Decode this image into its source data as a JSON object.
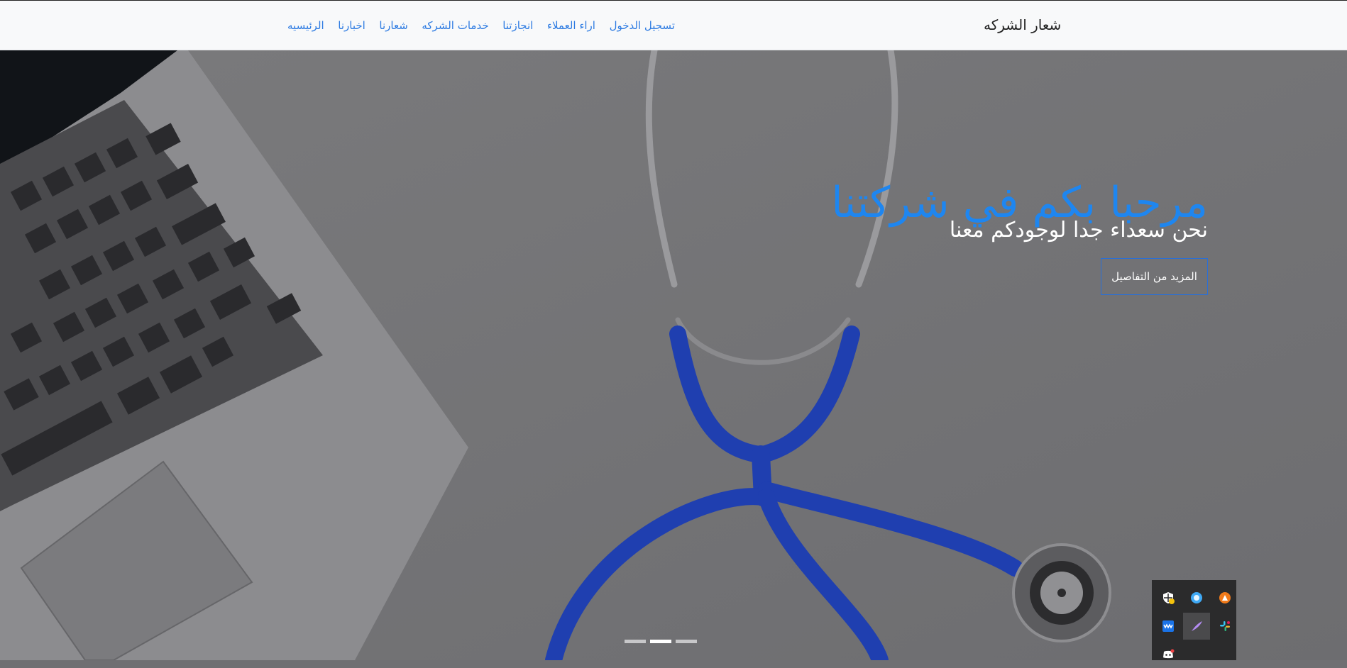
{
  "navbar": {
    "brand": "شعار الشركه",
    "links": [
      {
        "label": "الرئيسيه"
      },
      {
        "label": "اخبارنا"
      },
      {
        "label": "شعارنا"
      },
      {
        "label": "خدمات الشركه"
      },
      {
        "label": "انجازتنا"
      },
      {
        "label": "اراء العملاء"
      },
      {
        "label": "تسجيل الدخول"
      }
    ]
  },
  "hero": {
    "title": "مرحبا بكم في شركتنا",
    "subtitle": "نحن سعداء جدا لوجودكم معنا",
    "button_label": "المزيد من التفاصيل",
    "background_image": "laptop-and-stethoscope",
    "slides_count": 3,
    "active_slide": 2
  },
  "tray": {
    "icons": [
      "shield-warning-icon",
      "browser-globe-icon",
      "orange-app-icon",
      "wave-app-icon",
      "feather-pen-icon",
      "slack-app-icon",
      "discord-icon"
    ]
  },
  "colors": {
    "accent": "#1e86f0",
    "link": "#2d7be2",
    "navbar_bg": "#f8f9fa",
    "stethoscope": "#1f3fb0",
    "tray_bg": "#2b2b2c"
  }
}
